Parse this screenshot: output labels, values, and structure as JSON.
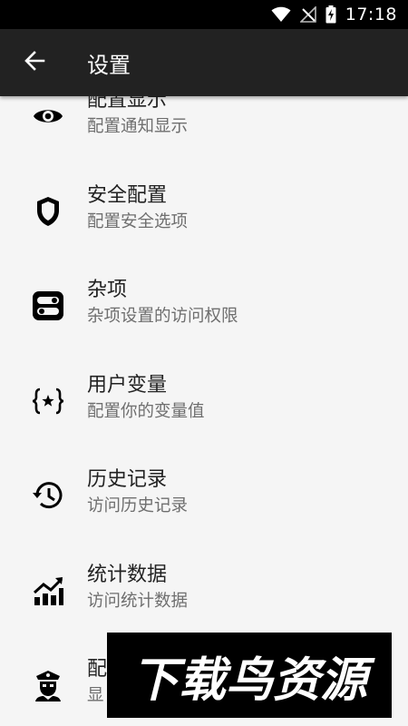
{
  "status_bar": {
    "time": "17:18"
  },
  "app_bar": {
    "title": "设置"
  },
  "items": [
    {
      "title": "配置显示",
      "subtitle": "配置通知显示",
      "icon": "eye-icon"
    },
    {
      "title": "安全配置",
      "subtitle": "配置安全选项",
      "icon": "shield-icon"
    },
    {
      "title": "杂项",
      "subtitle": "杂项设置的访问权限",
      "icon": "toggles-icon"
    },
    {
      "title": "用户变量",
      "subtitle": "配置你的变量值",
      "icon": "variable-braces-icon"
    },
    {
      "title": "历史记录",
      "subtitle": "访问历史记录",
      "icon": "history-icon"
    },
    {
      "title": "统计数据",
      "subtitle": "访问统计数据",
      "icon": "chart-icon"
    },
    {
      "title": "配",
      "subtitle": "显",
      "icon": "police-icon"
    }
  ],
  "watermark": {
    "text": "下载鸟资源"
  }
}
